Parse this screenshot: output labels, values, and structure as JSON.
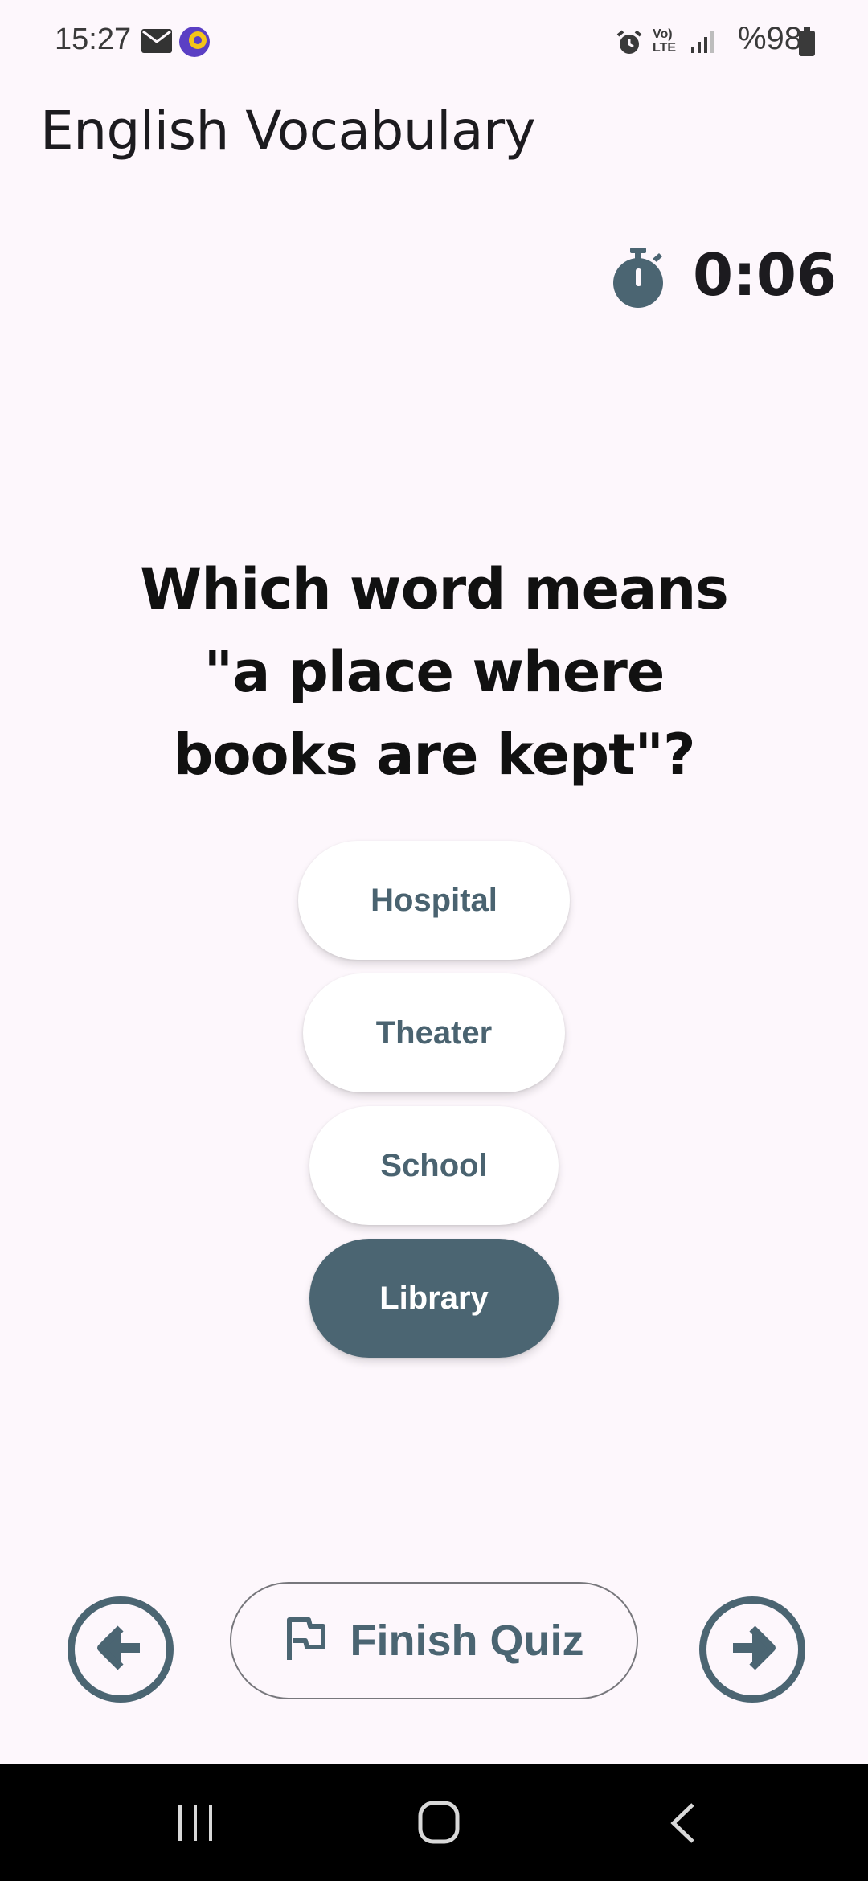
{
  "status_bar": {
    "time": "15:27",
    "battery_text": "%98",
    "icons": [
      "mail-icon",
      "app-notification-icon",
      "alarm-icon",
      "volte-icon",
      "signal-icon",
      "battery-icon"
    ]
  },
  "app_bar": {
    "title": "English Vocabulary"
  },
  "timer": {
    "icon": "stopwatch-icon",
    "value": "0:06"
  },
  "question": {
    "text": "Which word means \"a place where books are kept\"?"
  },
  "answers": [
    {
      "label": "Hospital",
      "selected": false
    },
    {
      "label": "Theater",
      "selected": false
    },
    {
      "label": "School",
      "selected": false
    },
    {
      "label": "Library",
      "selected": true
    }
  ],
  "bottom_nav": {
    "previous_icon": "arrow-left-icon",
    "next_icon": "arrow-right-icon",
    "finish_label": "Finish Quiz",
    "finish_icon": "flag-icon"
  },
  "system_nav": {
    "icons": [
      "recent-apps-icon",
      "home-icon",
      "back-icon"
    ]
  },
  "colors": {
    "background": "#fdf7fc",
    "accent": "#4b6572",
    "answer_text": "#4a6370"
  }
}
